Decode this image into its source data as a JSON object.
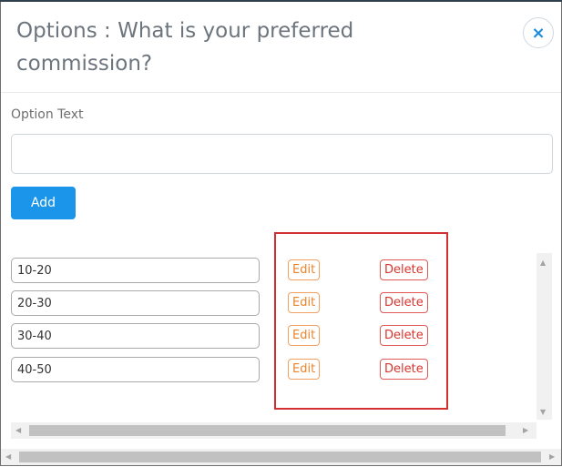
{
  "modal": {
    "title": "Options : What is your preferred commission?",
    "close_symbol": "×"
  },
  "form": {
    "option_label": "Option Text",
    "option_value": "",
    "option_placeholder": "",
    "add_label": "Add"
  },
  "options": [
    {
      "value": "10-20",
      "edit_label": "Edit",
      "delete_label": "Delete"
    },
    {
      "value": "20-30",
      "edit_label": "Edit",
      "delete_label": "Delete"
    },
    {
      "value": "30-40",
      "edit_label": "Edit",
      "delete_label": "Delete"
    },
    {
      "value": "40-50",
      "edit_label": "Edit",
      "delete_label": "Delete"
    }
  ],
  "colors": {
    "primary": "#1a95ea",
    "edit": "#e8852c",
    "delete": "#d9342e",
    "highlight": "#d33131"
  },
  "icons": {
    "close": "close-icon",
    "scroll_up": "arrow-up-icon",
    "scroll_down": "arrow-down-icon",
    "scroll_left": "arrow-left-icon",
    "scroll_right": "arrow-right-icon"
  }
}
